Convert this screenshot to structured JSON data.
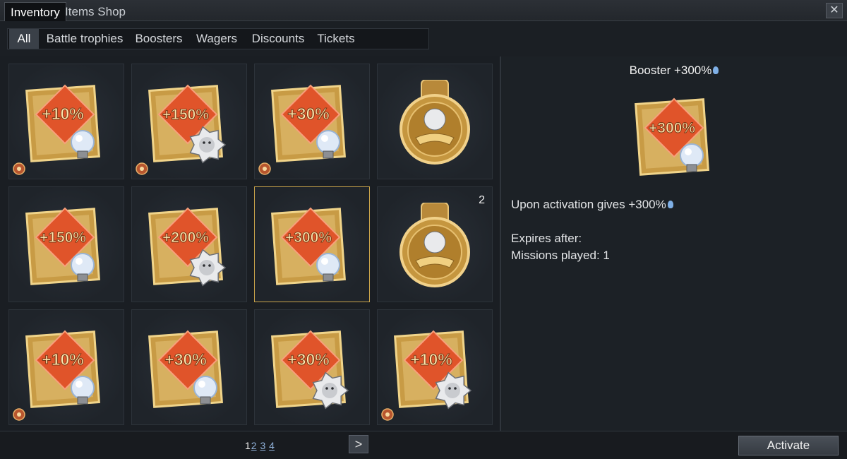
{
  "window": {
    "tabs": [
      {
        "label": "Inventory",
        "active": true
      },
      {
        "label": "Items Shop",
        "active": false
      }
    ],
    "close_label": "✕"
  },
  "filters": [
    {
      "label": "All",
      "active": true
    },
    {
      "label": "Battle trophies"
    },
    {
      "label": "Boosters"
    },
    {
      "label": "Wagers"
    },
    {
      "label": "Discounts"
    },
    {
      "label": "Tickets"
    }
  ],
  "grid": [
    {
      "kind": "booster",
      "value": "+10%",
      "emblem": "bulb-icon",
      "badge": "star-badge-icon"
    },
    {
      "kind": "booster",
      "value": "+150%",
      "emblem": "lion-icon",
      "badge": "star-badge-icon"
    },
    {
      "kind": "booster",
      "value": "+30%",
      "emblem": "bulb-icon",
      "badge": "star-badge-icon"
    },
    {
      "kind": "medal",
      "emblem": "handshake-lion-medal-icon"
    },
    {
      "kind": "booster",
      "value": "+150%",
      "emblem": "bulb-icon"
    },
    {
      "kind": "booster",
      "value": "+200%",
      "emblem": "lion-icon"
    },
    {
      "kind": "booster",
      "value": "+300%",
      "emblem": "bulb-icon",
      "selected": true
    },
    {
      "kind": "medal",
      "emblem": "handshake-lion-medal-icon",
      "count": "2"
    },
    {
      "kind": "booster",
      "value": "+10%",
      "emblem": "bulb-icon",
      "badge": "diamond-badge-icon"
    },
    {
      "kind": "booster",
      "value": "+30%",
      "emblem": "bulb-icon"
    },
    {
      "kind": "booster",
      "value": "+30%",
      "emblem": "lion-icon"
    },
    {
      "kind": "booster",
      "value": "+10%",
      "emblem": "lion-icon",
      "badge": "diamond-badge-icon"
    }
  ],
  "details": {
    "title": "Booster +300%",
    "item_value": "+300%",
    "description": "Upon activation gives +300%",
    "expires_label": "Expires after:",
    "missions_label": "Missions played: 1"
  },
  "footer": {
    "pages": [
      "1",
      "2",
      "3",
      "4"
    ],
    "current_page": "1",
    "next_label": ">",
    "activate_label": "Activate"
  },
  "colors": {
    "card_orange": "#e0542a",
    "frame_gold": "#c9a44a",
    "selection_border": "#c9a44a",
    "bulb_blue": "#7fb0e6"
  }
}
